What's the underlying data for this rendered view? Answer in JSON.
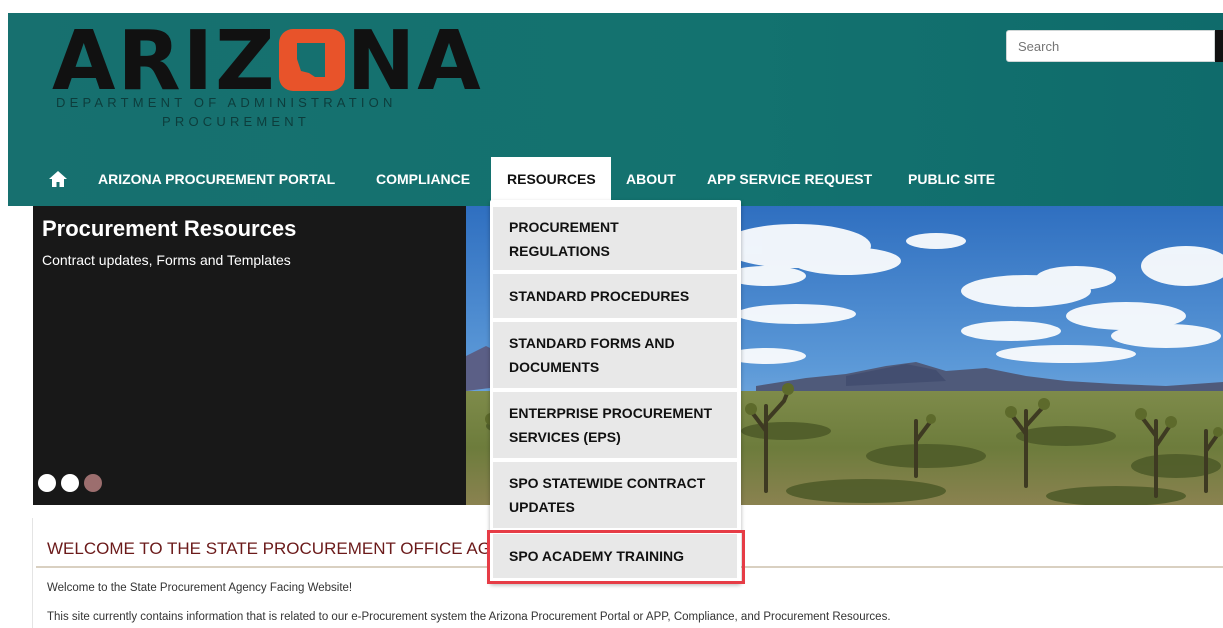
{
  "header": {
    "logo": {
      "word_left": "ARIZ",
      "word_right": "NA",
      "subtitle_1": "DEPARTMENT OF ADMINISTRATION",
      "subtitle_2": "PROCUREMENT"
    },
    "search": {
      "placeholder": "Search"
    }
  },
  "nav": {
    "items": [
      {
        "label": "ARIZONA PROCUREMENT PORTAL"
      },
      {
        "label": "COMPLIANCE"
      },
      {
        "label": "RESOURCES",
        "active": true
      },
      {
        "label": "ABOUT"
      },
      {
        "label": "APP SERVICE REQUEST"
      },
      {
        "label": "PUBLIC SITE"
      }
    ]
  },
  "dropdown": {
    "items": [
      {
        "label_1": "PROCUREMENT",
        "label_2": "REGULATIONS"
      },
      {
        "label_1": "STANDARD PROCEDURES"
      },
      {
        "label_1": "STANDARD FORMS AND",
        "label_2": "DOCUMENTS"
      },
      {
        "label_1": "ENTERPRISE PROCUREMENT",
        "label_2": "SERVICES (EPS)"
      },
      {
        "label_1": "SPO STATEWIDE CONTRACT",
        "label_2": "UPDATES"
      },
      {
        "label_1": "SPO ACADEMY TRAINING",
        "highlighted": true
      }
    ]
  },
  "hero": {
    "title": "Procurement Resources",
    "subtitle": "Contract updates, Forms and Templates",
    "dots_total": 3,
    "dots_active_index": 2
  },
  "content": {
    "welcome_title": "WELCOME TO THE STATE PROCUREMENT OFFICE AG",
    "paragraph_1": "Welcome to the State Procurement Agency Facing Website!",
    "paragraph_2": "This site currently contains information that is related to our e-Procurement system the Arizona Procurement Portal or APP, Compliance, and Procurement Resources."
  },
  "colors": {
    "header_teal": "#15706f",
    "logo_orange": "#e8532a",
    "highlight_red": "#e63c46",
    "welcome_title": "#6b1a1a"
  }
}
